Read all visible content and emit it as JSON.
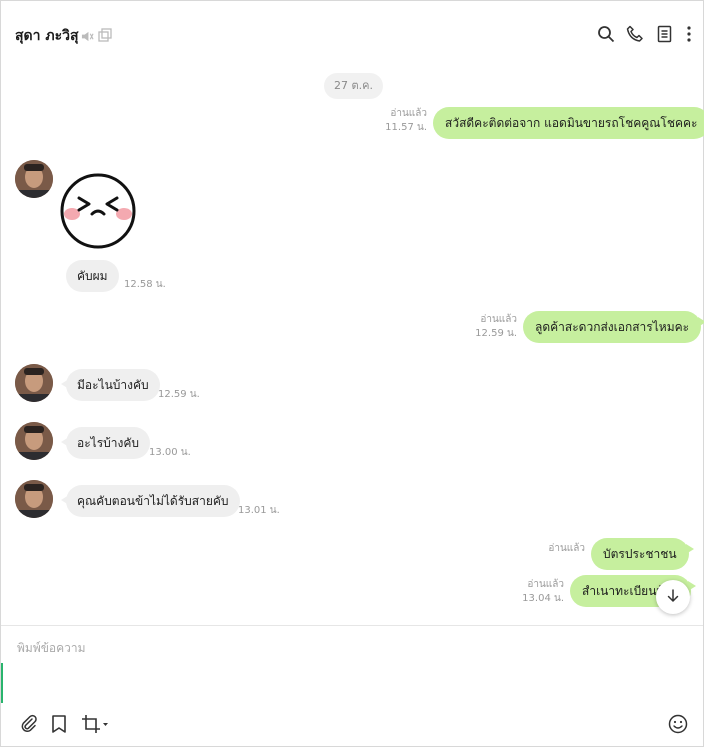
{
  "header": {
    "title": "สุดา ภะวิสุ",
    "left_icons": [
      "speaker-muted-icon",
      "popout-icon"
    ],
    "right_icons": [
      "search-icon",
      "phone-icon",
      "notes-icon",
      "more-vertical-icon"
    ]
  },
  "chat": {
    "date_chip": "27 ต.ค.",
    "messages": [
      {
        "dir": "out",
        "text": "สวัสดีคะติดต่อจาก แอดมินขายรถโชคคูณโชคคะ",
        "read": "อ่านแล้ว",
        "time": "11.57 น."
      },
      {
        "dir": "in",
        "type": "sticker",
        "sticker": "squinting-face-sticker"
      },
      {
        "dir": "in",
        "text": "คับผม",
        "time": "12.58 น."
      },
      {
        "dir": "out",
        "text": "ลูดค้าสะดวกส่งเอกสารไหมคะ",
        "read": "อ่านแล้ว",
        "time": "12.59 น."
      },
      {
        "dir": "in",
        "text": "มีอะไนบ้างคับ",
        "time": "12.59 น."
      },
      {
        "dir": "in",
        "text": "อะไรบ้างคับ",
        "time": "13.00 น."
      },
      {
        "dir": "in",
        "text": "คุณคับตอนข้าไม่ได้รับสายคับ",
        "time": "13.01 น."
      },
      {
        "dir": "out",
        "text": "บัตรประชาชน",
        "read": "อ่านแล้ว",
        "time": ""
      },
      {
        "dir": "out",
        "text": "สำเนาทะเบียนบ้าน",
        "read": "อ่านแล้ว",
        "time": "13.04 น."
      }
    ]
  },
  "composer": {
    "placeholder": "พิมพ์ข้อความ",
    "value": "",
    "icons": [
      "paperclip-icon",
      "bookmark-icon",
      "crop-icon",
      "emoji-icon"
    ]
  },
  "colors": {
    "outgoing_bubble": "#c6ef9e",
    "incoming_bubble": "#efefef",
    "accent_green": "#29b46d"
  }
}
